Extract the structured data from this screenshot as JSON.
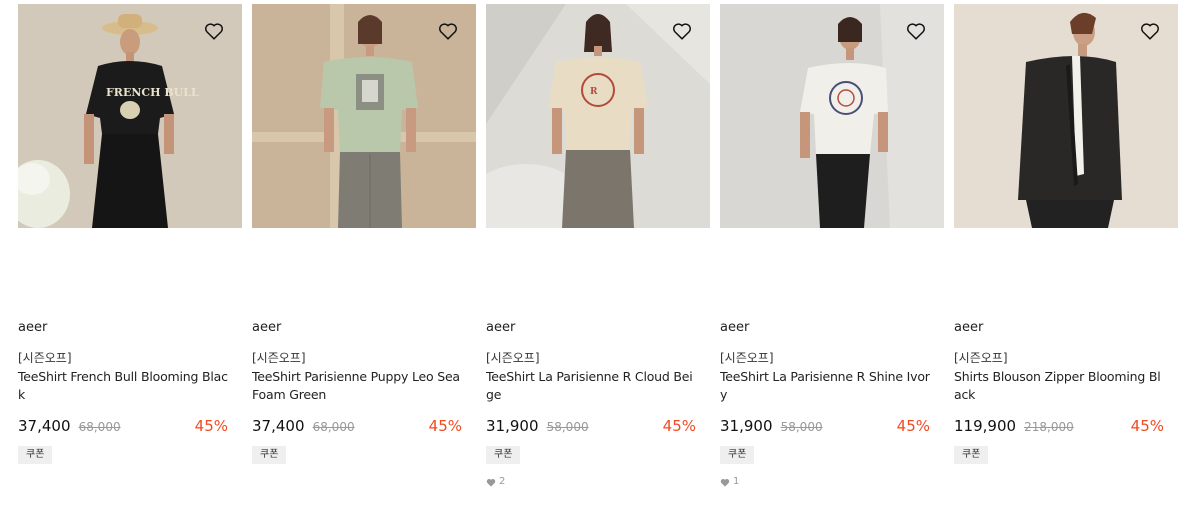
{
  "products": [
    {
      "brand": "aeer",
      "tag": "[시즌오프]",
      "name": "TeeShirt French Bull Blooming Black",
      "price": "37,400",
      "original_price": "68,000",
      "discount": "45%",
      "coupon": "쿠폰",
      "likes": "",
      "photo_icon": "model-black-tee-photo",
      "bg_color": "#d6cdbf"
    },
    {
      "brand": "aeer",
      "tag": "[시즌오프]",
      "name": "TeeShirt Parisienne Puppy Leo Sea Foam Green",
      "price": "37,400",
      "original_price": "68,000",
      "discount": "45%",
      "coupon": "쿠폰",
      "likes": "",
      "photo_icon": "model-green-tee-photo",
      "bg_color": "#c9b49a"
    },
    {
      "brand": "aeer",
      "tag": "[시즌오프]",
      "name": "TeeShirt La Parisienne R Cloud Beige",
      "price": "31,900",
      "original_price": "58,000",
      "discount": "45%",
      "coupon": "쿠폰",
      "likes": "2",
      "photo_icon": "model-beige-tee-photo",
      "bg_color": "#dcdbd6"
    },
    {
      "brand": "aeer",
      "tag": "[시즌오프]",
      "name": "TeeShirt La Parisienne R Shine Ivory",
      "price": "31,900",
      "original_price": "58,000",
      "discount": "45%",
      "coupon": "쿠폰",
      "likes": "1",
      "photo_icon": "model-ivory-tee-photo",
      "bg_color": "#d8d7d3"
    },
    {
      "brand": "aeer",
      "tag": "[시즌오프]",
      "name": "Shirts Blouson Zipper Blooming Black",
      "price": "119,900",
      "original_price": "218,000",
      "discount": "45%",
      "coupon": "쿠폰",
      "likes": "",
      "photo_icon": "model-black-blouson-photo",
      "bg_color": "#e6ddd2"
    }
  ],
  "colors": {
    "discount": "#f04a23",
    "price": "#111111",
    "original_price": "#999999",
    "coupon_bg": "#efefef"
  }
}
